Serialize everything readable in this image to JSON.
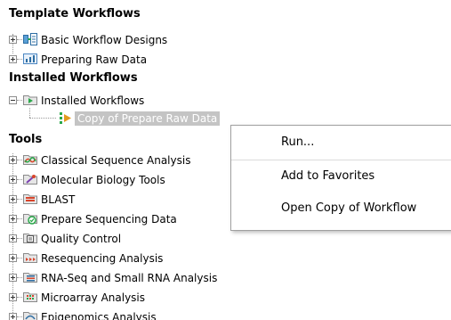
{
  "sections": {
    "template": {
      "heading": "Template Workflows",
      "items": [
        {
          "label": "Basic Workflow Designs",
          "icon": "workflow-designs-icon"
        },
        {
          "label": "Preparing Raw Data",
          "icon": "chart-folder-icon"
        }
      ]
    },
    "installed": {
      "heading": "Installed Workflows",
      "folder": {
        "label": "Installed Workflows",
        "icon": "folder-workflow-icon"
      },
      "child": {
        "label": "Copy of Prepare Raw Data",
        "icon": "workflow-item-icon"
      }
    },
    "tools": {
      "heading": "Tools",
      "items": [
        {
          "label": "Classical Sequence Analysis",
          "icon": "sequence-analysis-icon"
        },
        {
          "label": "Molecular Biology Tools",
          "icon": "molecular-biology-icon"
        },
        {
          "label": "BLAST",
          "icon": "blast-icon"
        },
        {
          "label": "Prepare Sequencing Data",
          "icon": "prepare-sequencing-icon"
        },
        {
          "label": "Quality Control",
          "icon": "quality-control-icon"
        },
        {
          "label": "Resequencing Analysis",
          "icon": "resequencing-icon"
        },
        {
          "label": "RNA-Seq and Small RNA Analysis",
          "icon": "rna-seq-icon"
        },
        {
          "label": "Microarray Analysis",
          "icon": "microarray-icon"
        },
        {
          "label": "Epigenomics Analysis",
          "icon": "epigenomics-icon"
        }
      ]
    }
  },
  "context_menu": {
    "items": [
      {
        "label": "Run..."
      },
      {
        "label": "Add to Favorites"
      },
      {
        "label": "Open Copy of Workflow"
      }
    ]
  },
  "colors": {
    "selection_bg": "#c4c4c4",
    "menu_border": "#a0a0a0"
  }
}
